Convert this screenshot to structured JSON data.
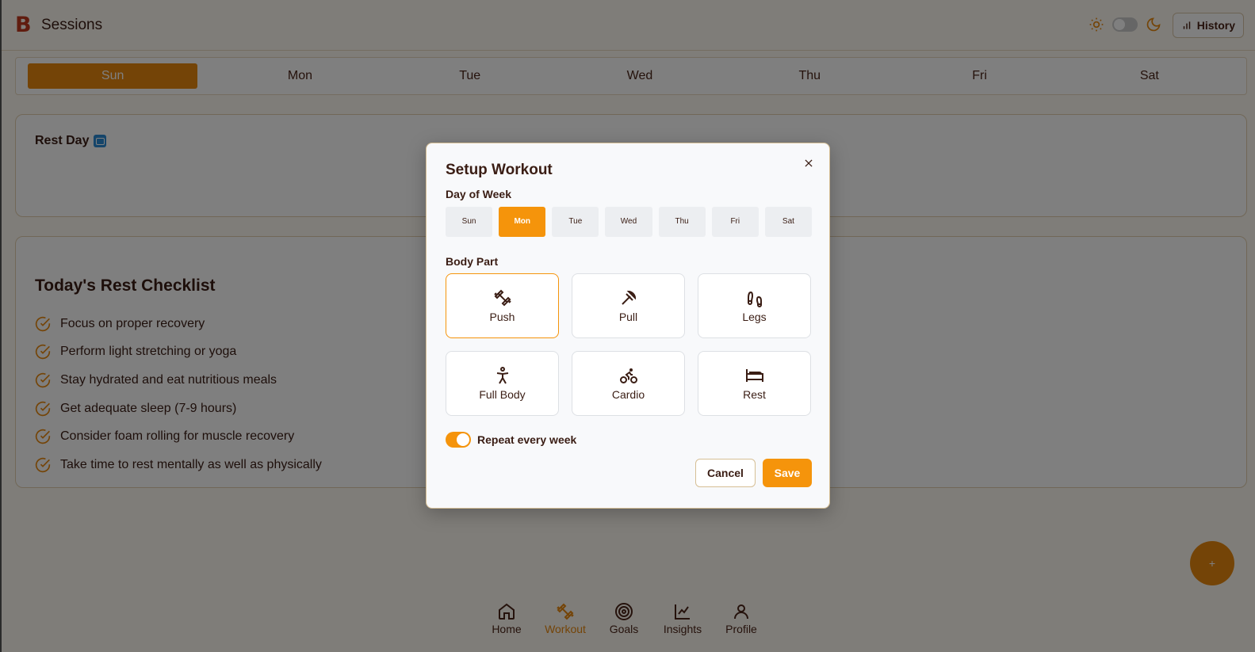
{
  "header": {
    "logo_letter": "B",
    "title": "Sessions",
    "history_label": "History"
  },
  "day_tabs": [
    {
      "label": "Sun",
      "active": true
    },
    {
      "label": "Mon",
      "active": false
    },
    {
      "label": "Tue",
      "active": false
    },
    {
      "label": "Wed",
      "active": false
    },
    {
      "label": "Thu",
      "active": false
    },
    {
      "label": "Fri",
      "active": false
    },
    {
      "label": "Sat",
      "active": false
    }
  ],
  "rest_card": {
    "title": "Rest Day"
  },
  "checklist": {
    "title": "Today's Rest Checklist",
    "items": [
      "Focus on proper recovery",
      "Perform light stretching or yoga",
      "Stay hydrated and eat nutritious meals",
      "Get adequate sleep (7-9 hours)",
      "Consider foam rolling for muscle recovery",
      "Take time to rest mentally as well as physically"
    ]
  },
  "fab": {
    "label": "+"
  },
  "bottom_nav": [
    {
      "label": "Home",
      "icon": "home-icon",
      "active": false
    },
    {
      "label": "Workout",
      "icon": "dumbbell-icon",
      "active": true
    },
    {
      "label": "Goals",
      "icon": "target-icon",
      "active": false
    },
    {
      "label": "Insights",
      "icon": "chart-line-icon",
      "active": false
    },
    {
      "label": "Profile",
      "icon": "user-icon",
      "active": false
    }
  ],
  "modal": {
    "title": "Setup Workout",
    "day_of_week_label": "Day of Week",
    "days": [
      {
        "label": "Sun",
        "active": false
      },
      {
        "label": "Mon",
        "active": true
      },
      {
        "label": "Tue",
        "active": false
      },
      {
        "label": "Wed",
        "active": false
      },
      {
        "label": "Thu",
        "active": false
      },
      {
        "label": "Fri",
        "active": false
      },
      {
        "label": "Sat",
        "active": false
      }
    ],
    "body_part_label": "Body Part",
    "body_parts": [
      {
        "label": "Push",
        "icon": "dumbbell-icon",
        "active": true
      },
      {
        "label": "Pull",
        "icon": "pull-icon",
        "active": false
      },
      {
        "label": "Legs",
        "icon": "footprints-icon",
        "active": false
      },
      {
        "label": "Full Body",
        "icon": "person-icon",
        "active": false
      },
      {
        "label": "Cardio",
        "icon": "bike-icon",
        "active": false
      },
      {
        "label": "Rest",
        "icon": "bed-icon",
        "active": false
      }
    ],
    "repeat_label": "Repeat every week",
    "repeat_enabled": true,
    "cancel_label": "Cancel",
    "save_label": "Save"
  },
  "colors": {
    "accent": "#f5940b",
    "accent_dark": "#e8880e",
    "text": "#3a1d14",
    "logo": "#c0391f"
  }
}
